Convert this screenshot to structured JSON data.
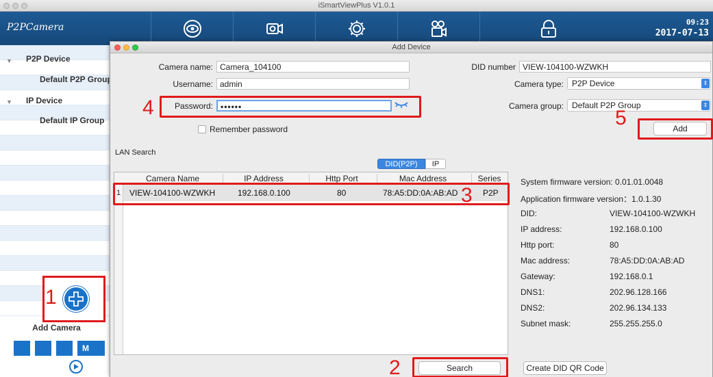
{
  "main_window": {
    "title": "iSmartViewPlus  V1.0.1",
    "logo": "P2PCamera",
    "clock_time": "09:23",
    "clock_date": "2017-07-13",
    "toolbar_icons": [
      "eye-icon",
      "camera-icon",
      "settings-icon",
      "playback-icon",
      "lock-icon"
    ]
  },
  "sidebar": {
    "p2p_device": "P2P Device",
    "p2p_group": "Default P2P Group",
    "ip_device": "IP Device",
    "ip_group": "Default IP Group",
    "add_camera": "Add Camera",
    "layout_m": "M"
  },
  "dialog": {
    "title": "Add Device",
    "camera_name_label": "Camera name:",
    "camera_name_value": "Camera_104100",
    "username_label": "Username:",
    "username_value": "admin",
    "password_label": "Password:",
    "password_value": "••••••",
    "remember_label": "Remember password",
    "did_label": "DID number",
    "did_value": "VIEW-104100-WZWKH",
    "camera_type_label": "Camera type:",
    "camera_type_value": "P2P Device",
    "camera_group_label": "Camera group:",
    "camera_group_value": "Default P2P Group",
    "add_button": "Add",
    "lan_search_label": "LAN Search",
    "tabs": [
      "DID(P2P)",
      "IP"
    ],
    "table": {
      "headers": [
        "Camera Name",
        "IP Address",
        "Http Port",
        "Mac Address",
        "Series"
      ],
      "rows": [
        {
          "no": "1",
          "camera_name": "VIEW-104100-WZWKH",
          "ip": "192.168.0.100",
          "port": "80",
          "mac": "78:A5:DD:0A:AB:AD",
          "series": "P2P"
        }
      ]
    },
    "info": {
      "system_fw": "System firmware version: 0.01.01.0048",
      "app_fw": "Application firmware version：1.0.1.30",
      "rows": [
        {
          "k": "DID:",
          "v": "VIEW-104100-WZWKH"
        },
        {
          "k": "IP address:",
          "v": "192.168.0.100"
        },
        {
          "k": "Http port:",
          "v": "80"
        },
        {
          "k": "Mac address:",
          "v": "78:A5:DD:0A:AB:AD"
        },
        {
          "k": "Gateway:",
          "v": "192.168.0.1"
        },
        {
          "k": "DNS1:",
          "v": "202.96.128.166"
        },
        {
          "k": "DNS2:",
          "v": "202.96.134.133"
        },
        {
          "k": "Subnet mask:",
          "v": "255.255.255.0"
        }
      ]
    },
    "search_button": "Search",
    "qr_button": "Create DID QR Code"
  },
  "annotations": {
    "step1": "1",
    "step2": "2",
    "step3": "3",
    "step4": "4",
    "step5": "5",
    "color": "#e0191a"
  }
}
